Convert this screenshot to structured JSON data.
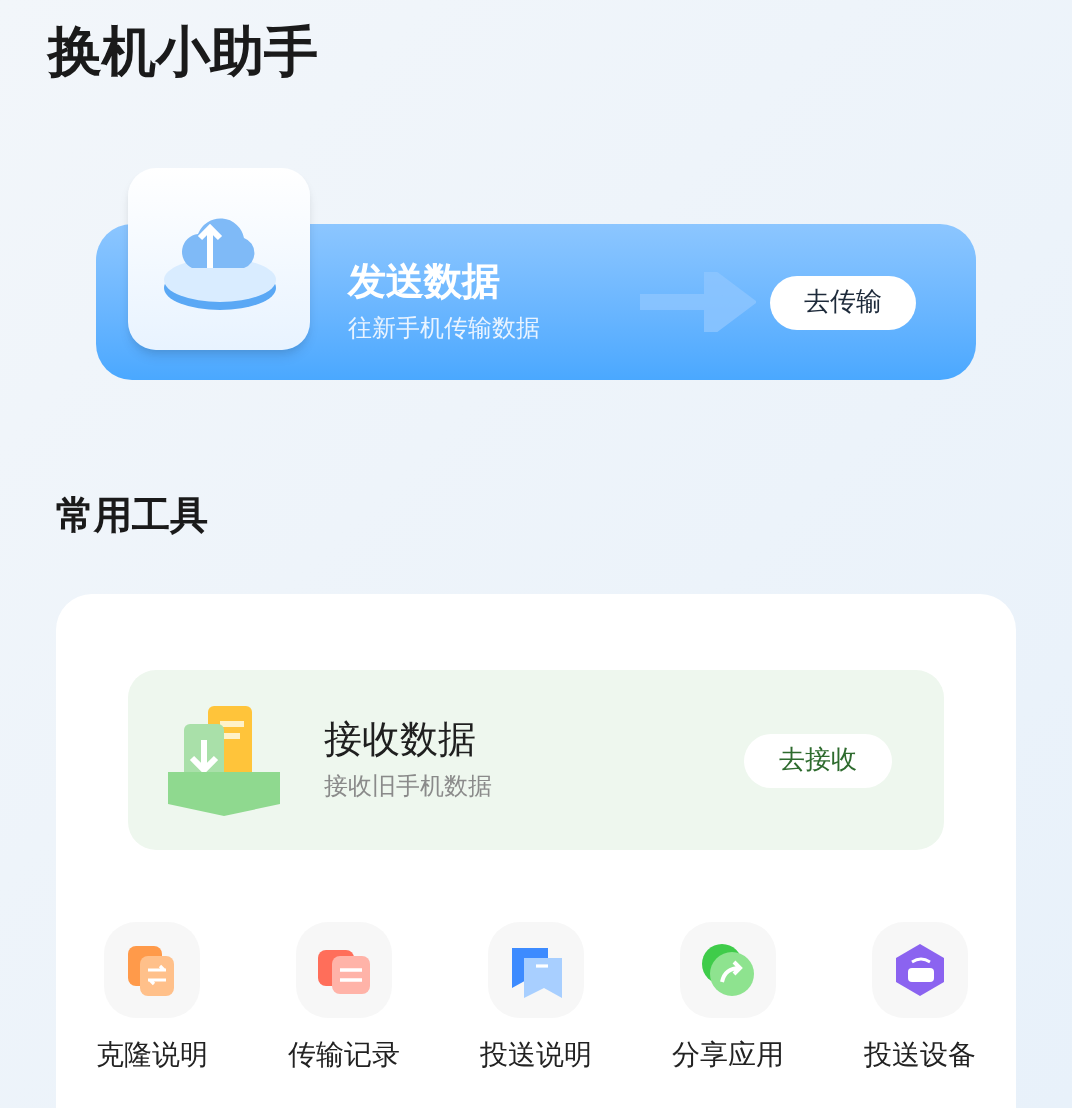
{
  "title": "换机小助手",
  "send": {
    "title": "发送数据",
    "subtitle": "往新手机传输数据",
    "button": "去传输"
  },
  "section_title": "常用工具",
  "receive": {
    "title": "接收数据",
    "subtitle": "接收旧手机数据",
    "button": "去接收"
  },
  "tools": [
    {
      "label": "克隆说明"
    },
    {
      "label": "传输记录"
    },
    {
      "label": "投送说明"
    },
    {
      "label": "分享应用"
    },
    {
      "label": "投送设备"
    }
  ]
}
